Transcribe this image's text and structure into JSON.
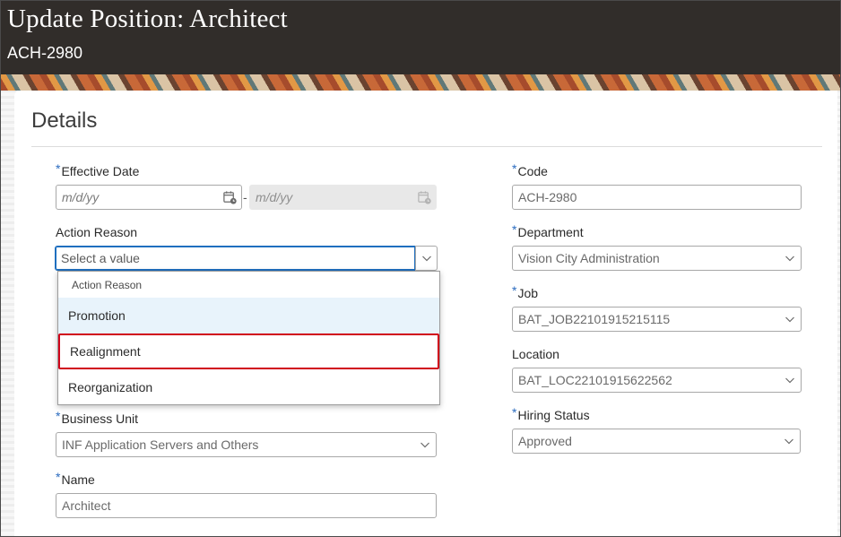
{
  "header": {
    "title": "Update Position: Architect",
    "subtitle": "ACH-2980"
  },
  "section": {
    "title": "Details"
  },
  "required_marker": "*",
  "effective_date": {
    "label": "Effective Date",
    "required": true,
    "start_placeholder": "m/d/yy",
    "separator": "-",
    "end_placeholder": "m/d/yy"
  },
  "action_reason": {
    "label": "Action Reason",
    "placeholder": "Select a value",
    "dropdown": {
      "header": "Action Reason",
      "options": [
        "Promotion",
        "Realignment",
        "Reorganization"
      ],
      "highlighted": "Promotion",
      "boxed": "Realignment"
    }
  },
  "business_unit": {
    "label": "Business Unit",
    "required": true,
    "value": "INF Application Servers and Others"
  },
  "name": {
    "label": "Name",
    "required": true,
    "value": "Architect"
  },
  "code": {
    "label": "Code",
    "required": true,
    "value": "ACH-2980"
  },
  "department": {
    "label": "Department",
    "required": true,
    "value": "Vision City Administration"
  },
  "job": {
    "label": "Job",
    "required": true,
    "value": "BAT_JOB22101915215115"
  },
  "location": {
    "label": "Location",
    "required": false,
    "value": "BAT_LOC22101915622562"
  },
  "hiring_status": {
    "label": "Hiring Status",
    "required": true,
    "value": "Approved"
  },
  "colors": {
    "header_bg": "#312d2a",
    "required": "#2a6bbf",
    "focus": "#1f6fbf",
    "highlight": "#e8f3fb",
    "annotation": "#d0021b"
  }
}
